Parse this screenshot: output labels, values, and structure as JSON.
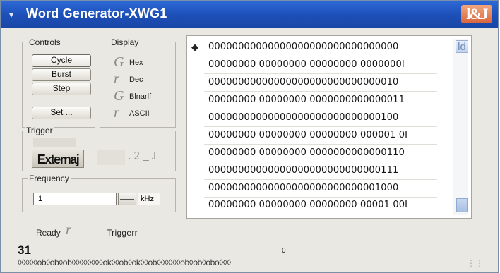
{
  "window": {
    "title": "Word Generator-XWG1",
    "close_icon_text": "l&J"
  },
  "controls": {
    "label": "Controls",
    "cycle": "Cycle",
    "burst": "Burst",
    "step": "Step",
    "set": "Set ..."
  },
  "display": {
    "label": "Display",
    "hex": {
      "glyph": "G",
      "label": "Hex"
    },
    "dec": {
      "glyph": "r",
      "label": "Dec"
    },
    "binary": {
      "glyph": "G",
      "label": "Blnarlf"
    },
    "ascii": {
      "glyph": "r",
      "label": "ASCII"
    }
  },
  "trigger": {
    "label": "Trigger",
    "external": "Extemaj",
    "field": ". 2 _ J"
  },
  "frequency": {
    "label": "Frequency",
    "value": "1",
    "unit": "kHz"
  },
  "data": {
    "marker": "◆",
    "rows": [
      "00000000000000000000000000000000",
      "00000000 00000000 00000000 0000000I",
      "00000000000000000000000000000010",
      "00000000 00000000 0000000000000011",
      "00000000000000000000000000000100",
      "00000000 00000000 00000000 000001 0I",
      "00000000 00000000 0000000000000110",
      "00000000000000000000000000000111",
      "00000000000000000000000000001000",
      "00000000 00000000 00000000 00001 00I"
    ],
    "scroll_top_glyph": "ld"
  },
  "status": {
    "ready": "Ready",
    "ready_glyph": "r",
    "trigger": "Triggerr",
    "bit_high": "31",
    "bit_low": "0",
    "bits": "◊◊◊◊◊ob◊ob◊ob◊◊◊◊◊◊◊◊ok◊◊ob◊ok◊◊ob◊◊◊◊◊◊ob◊ob◊obo◊◊◊"
  }
}
